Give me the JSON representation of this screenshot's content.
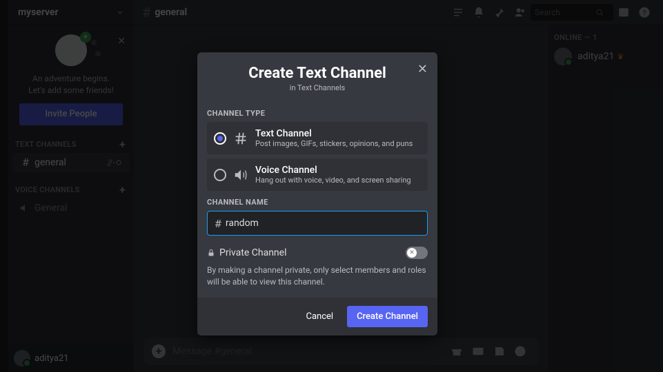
{
  "server": {
    "name": "myserver"
  },
  "friendsCard": {
    "line1": "An adventure begins.",
    "line2": "Let's add some friends!",
    "invite": "Invite People"
  },
  "sidebar": {
    "textHeader": "TEXT CHANNELS",
    "voiceHeader": "VOICE CHANNELS",
    "textChannels": [
      {
        "name": "general",
        "selected": true
      }
    ],
    "voiceChannels": [
      {
        "name": "General"
      }
    ]
  },
  "topbar": {
    "channel": "general",
    "searchPlaceholder": "Search"
  },
  "composer": {
    "placeholder": "Message #general"
  },
  "members": {
    "header": "ONLINE — 1",
    "list": [
      {
        "name": "aditya21",
        "owner": true
      }
    ]
  },
  "userPanel": {
    "name": "aditya21"
  },
  "modal": {
    "title": "Create Text Channel",
    "subtitle": "in Text Channels",
    "channelTypeLabel": "CHANNEL TYPE",
    "types": [
      {
        "title": "Text Channel",
        "desc": "Post images, GIFs, stickers, opinions, and puns",
        "selected": true,
        "icon": "hash"
      },
      {
        "title": "Voice Channel",
        "desc": "Hang out with voice, video, and screen sharing",
        "selected": false,
        "icon": "speaker"
      }
    ],
    "channelNameLabel": "CHANNEL NAME",
    "channelName": "random",
    "privateLabel": "Private Channel",
    "privateDesc": "By making a channel private, only select members and roles will be able to view this channel.",
    "privateOn": false,
    "cancel": "Cancel",
    "create": "Create Channel"
  },
  "colors": {
    "accent": "#5865f2",
    "green": "#3ba55d",
    "focusBlue": "#1c9cf0",
    "crown": "#faa61a"
  }
}
